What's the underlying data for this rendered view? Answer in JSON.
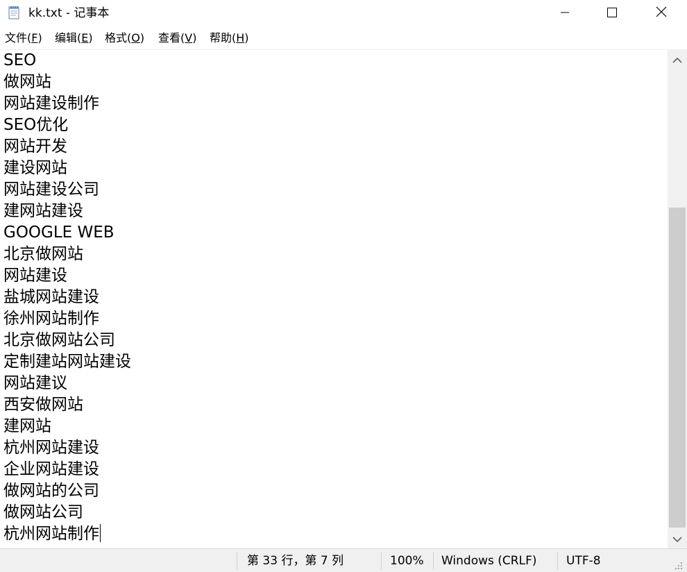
{
  "window": {
    "title": "kk.txt - 记事本",
    "icons": {
      "app": "notepad-icon",
      "minimize": "minimize-icon",
      "maximize": "maximize-icon",
      "close": "close-icon"
    }
  },
  "menu": [
    {
      "label": "文件(",
      "mnemonic": "F",
      "suffix": ")"
    },
    {
      "label": "编辑(",
      "mnemonic": "E",
      "suffix": ")"
    },
    {
      "label": "格式(",
      "mnemonic": "O",
      "suffix": ")"
    },
    {
      "label": "查看(",
      "mnemonic": "V",
      "suffix": ")"
    },
    {
      "label": "帮助(",
      "mnemonic": "H",
      "suffix": ")"
    }
  ],
  "editor": {
    "lines": [
      "SEO",
      "做网站",
      "网站建设制作",
      "SEO优化",
      "网站开发",
      "建设网站",
      "网站建设公司",
      "建网站建设",
      "GOOGLE WEB",
      "北京做网站",
      "网站建设",
      "盐城网站建设",
      "徐州网站制作",
      "北京做网站公司",
      "定制建站网站建设",
      "网站建议",
      "西安做网站",
      "建网站",
      "杭州网站建设",
      "企业网站建设",
      "做网站的公司",
      "做网站公司",
      "杭州网站制作"
    ]
  },
  "scrollbar": {
    "up_icon": "chevron-up-icon",
    "down_icon": "chevron-down-icon"
  },
  "status": {
    "position": "第 33 行，第 7 列",
    "zoom": "100%",
    "line_ending": "Windows (CRLF)",
    "encoding": "UTF-8"
  }
}
